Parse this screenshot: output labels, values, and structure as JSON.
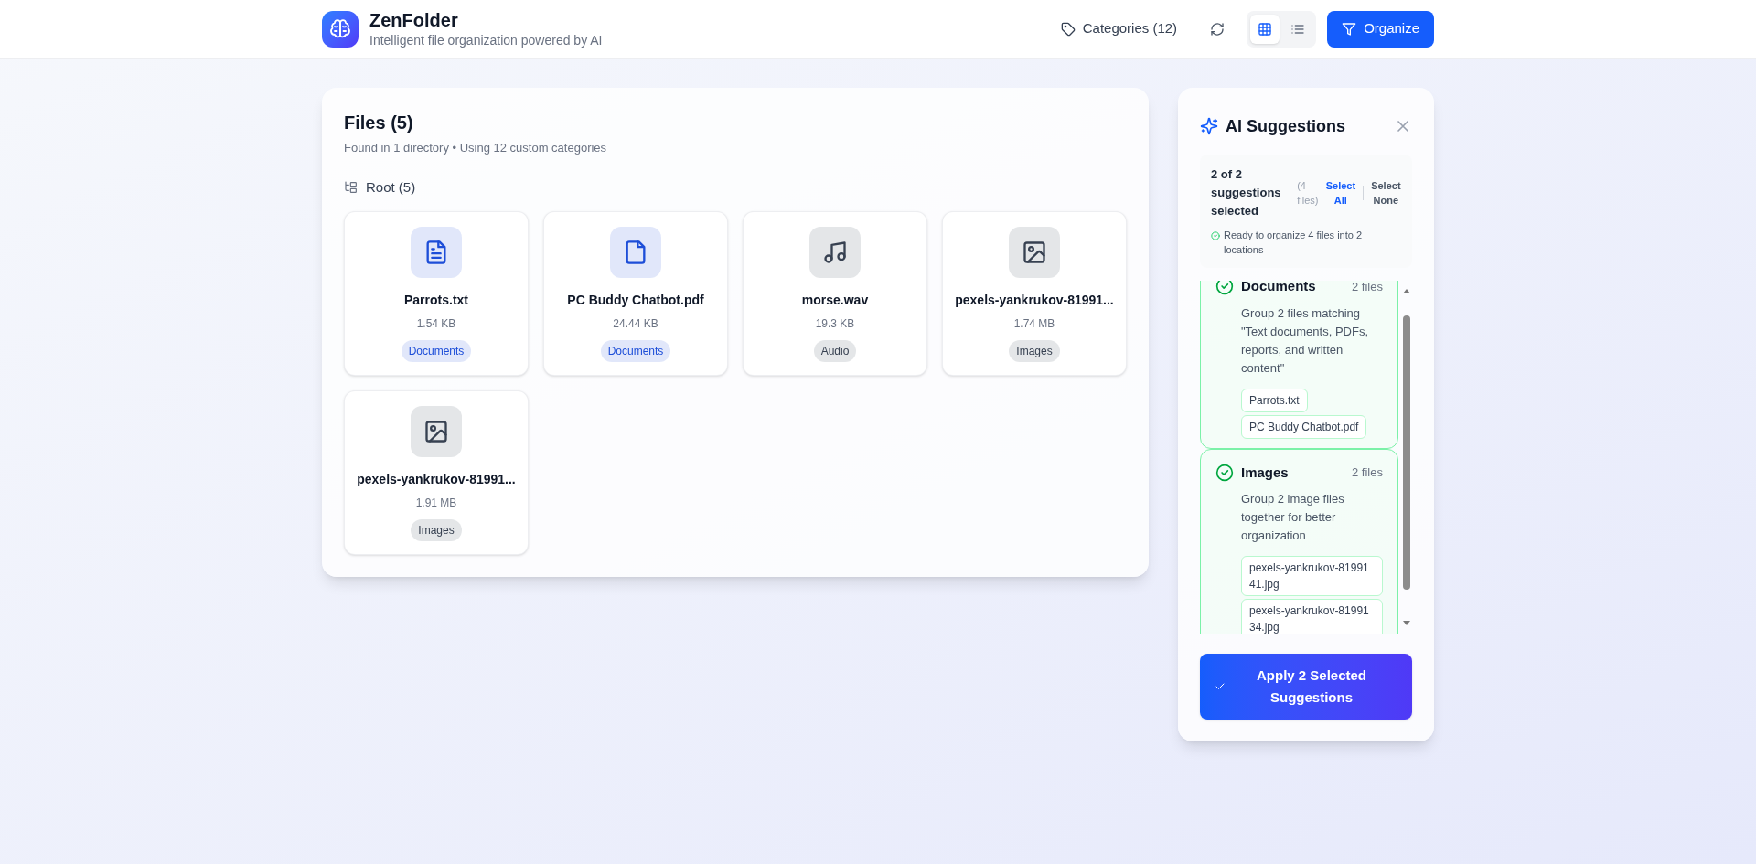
{
  "header": {
    "title": "ZenFolder",
    "subtitle": "Intelligent file organization powered by AI",
    "categories_button": "Categories (12)",
    "view_modes": [
      {
        "kind": "grid",
        "selected": true
      },
      {
        "kind": "list",
        "selected": false
      }
    ],
    "organize_button": "Organize"
  },
  "files": {
    "title": "Files (5)",
    "subtitle": "Found in 1 directory • Using 12 custom categories",
    "group": {
      "label": "Root (5)",
      "files": [
        {
          "name": "Parrots.txt",
          "size": "1.54 KB",
          "category": "Documents",
          "kind": "text",
          "color": "#1d4ed8"
        },
        {
          "name": "PC Buddy Chatbot.pdf",
          "size": "24.44 KB",
          "category": "Documents",
          "kind": "file",
          "color": "#1d4ed8"
        },
        {
          "name": "morse.wav",
          "size": "19.3 KB",
          "category": "Audio",
          "kind": "audio",
          "color": "#374151"
        },
        {
          "name": "pexels-yankrukov-81991...",
          "size": "1.74 MB",
          "category": "Images",
          "kind": "image",
          "color": "#374151"
        },
        {
          "name": "pexels-yankrukov-81991...",
          "size": "1.91 MB",
          "category": "Images",
          "kind": "image",
          "color": "#374151"
        }
      ]
    }
  },
  "suggestions_panel": {
    "title": "AI Suggestions",
    "summary": {
      "selected_text": "2 of 2 suggestions selected",
      "file_count": "(4 files)",
      "select_all": "Select All",
      "select_none": "Select None",
      "status": "Ready to organize 4 files into 2 locations"
    },
    "suggestions": [
      {
        "name": "Documents",
        "count": "2 files",
        "description": "Group 2 files matching \"Text documents, PDFs, reports, and written content\"",
        "files": [
          "Parrots.txt",
          "PC Buddy Chatbot.pdf"
        ],
        "selected": true
      },
      {
        "name": "Images",
        "count": "2 files",
        "description": "Group 2 image files together for better organization",
        "files": [
          "pexels-yankrukov-8199141.jpg",
          "pexels-yankrukov-8199134.jpg"
        ],
        "selected": true
      }
    ],
    "apply_button": "Apply 2 Selected Suggestions"
  }
}
